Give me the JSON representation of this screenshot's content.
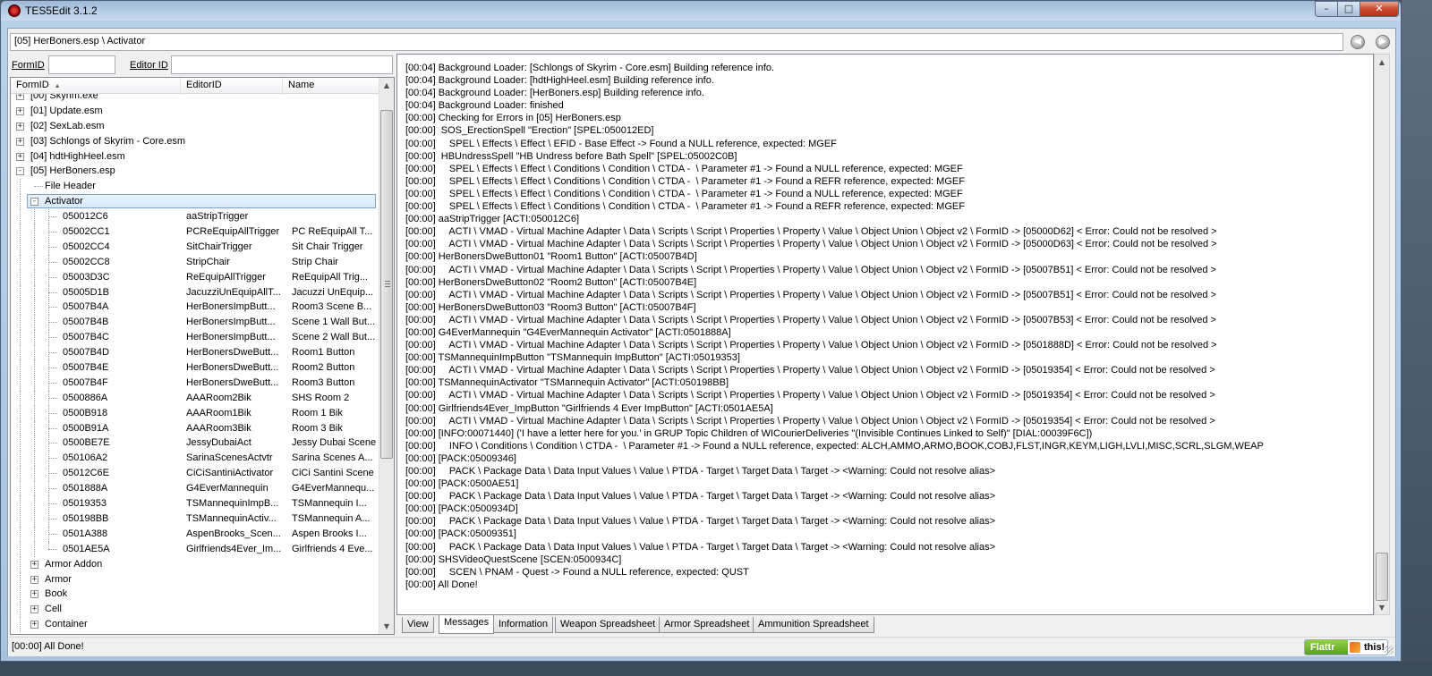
{
  "window": {
    "title": "TES5Edit 3.1.2",
    "minimize": "–",
    "maximize": "□",
    "close": "✕"
  },
  "path": {
    "value": "[05] HerBoners.esp \\ Activator",
    "back_icon": "arrow-left-icon",
    "forward_icon": "arrow-right-icon"
  },
  "filters": {
    "formid_label": "FormID",
    "formid_value": "",
    "editorid_label": "Editor ID",
    "editorid_value": ""
  },
  "tree": {
    "columns": [
      "FormID",
      "EditorID",
      "Name"
    ],
    "rows": [
      {
        "level": 0,
        "exp": "+",
        "formid": "[00] Skyrim.exe",
        "editorid": "",
        "name": ""
      },
      {
        "level": 0,
        "exp": "+",
        "formid": "[01] Update.esm",
        "editorid": "",
        "name": ""
      },
      {
        "level": 0,
        "exp": "+",
        "formid": "[02] SexLab.esm",
        "editorid": "",
        "name": ""
      },
      {
        "level": 0,
        "exp": "+",
        "formid": "[03] Schlongs of Skyrim - Core.esm",
        "editorid": "",
        "name": ""
      },
      {
        "level": 0,
        "exp": "+",
        "formid": "[04] hdtHighHeel.esm",
        "editorid": "",
        "name": ""
      },
      {
        "level": 0,
        "exp": "−",
        "formid": "[05] HerBoners.esp",
        "editorid": "",
        "name": ""
      },
      {
        "level": 1,
        "exp": "",
        "formid": "File Header",
        "editorid": "",
        "name": ""
      },
      {
        "level": 1,
        "exp": "−",
        "formid": "Activator",
        "editorid": "",
        "name": "",
        "selected": true
      },
      {
        "level": 2,
        "exp": "",
        "formid": "050012C6",
        "editorid": "aaStripTrigger",
        "name": ""
      },
      {
        "level": 2,
        "exp": "",
        "formid": "05002CC1",
        "editorid": "PCReEquipAllTrigger",
        "name": "PC ReEquipAll T..."
      },
      {
        "level": 2,
        "exp": "",
        "formid": "05002CC4",
        "editorid": "SitChairTrigger",
        "name": "Sit Chair Trigger"
      },
      {
        "level": 2,
        "exp": "",
        "formid": "05002CC8",
        "editorid": "StripChair",
        "name": "Strip Chair"
      },
      {
        "level": 2,
        "exp": "",
        "formid": "05003D3C",
        "editorid": "ReEquipAllTrigger",
        "name": "ReEquipAll Trig..."
      },
      {
        "level": 2,
        "exp": "",
        "formid": "05005D1B",
        "editorid": "JacuzziUnEquipAllT...",
        "name": "Jacuzzi UnEquip..."
      },
      {
        "level": 2,
        "exp": "",
        "formid": "05007B4A",
        "editorid": "HerBonersImpButt...",
        "name": "Room3 Scene B..."
      },
      {
        "level": 2,
        "exp": "",
        "formid": "05007B4B",
        "editorid": "HerBonersImpButt...",
        "name": "Scene 1 Wall But..."
      },
      {
        "level": 2,
        "exp": "",
        "formid": "05007B4C",
        "editorid": "HerBonersImpButt...",
        "name": "Scene 2 Wall But..."
      },
      {
        "level": 2,
        "exp": "",
        "formid": "05007B4D",
        "editorid": "HerBonersDweButt...",
        "name": "Room1 Button"
      },
      {
        "level": 2,
        "exp": "",
        "formid": "05007B4E",
        "editorid": "HerBonersDweButt...",
        "name": "Room2 Button"
      },
      {
        "level": 2,
        "exp": "",
        "formid": "05007B4F",
        "editorid": "HerBonersDweButt...",
        "name": "Room3 Button"
      },
      {
        "level": 2,
        "exp": "",
        "formid": "0500886A",
        "editorid": "AAARoom2Bik",
        "name": "SHS Room 2"
      },
      {
        "level": 2,
        "exp": "",
        "formid": "0500B918",
        "editorid": "AAARoom1Bik",
        "name": "Room 1 Bik"
      },
      {
        "level": 2,
        "exp": "",
        "formid": "0500B91A",
        "editorid": "AAARoom3Bik",
        "name": "Room 3 Bik"
      },
      {
        "level": 2,
        "exp": "",
        "formid": "0500BE7E",
        "editorid": "JessyDubaiAct",
        "name": "Jessy Dubai Scene"
      },
      {
        "level": 2,
        "exp": "",
        "formid": "050106A2",
        "editorid": "SarinaScenesActvtr",
        "name": "Sarina Scenes A..."
      },
      {
        "level": 2,
        "exp": "",
        "formid": "05012C6E",
        "editorid": "CiCiSantiniActivator",
        "name": "CiCi Santini Scene"
      },
      {
        "level": 2,
        "exp": "",
        "formid": "0501888A",
        "editorid": "G4EverMannequin",
        "name": "G4EverMannequ..."
      },
      {
        "level": 2,
        "exp": "",
        "formid": "05019353",
        "editorid": "TSMannequinImpB...",
        "name": "TSMannequin I..."
      },
      {
        "level": 2,
        "exp": "",
        "formid": "050198BB",
        "editorid": "TSMannequinActiv...",
        "name": "TSMannequin A..."
      },
      {
        "level": 2,
        "exp": "",
        "formid": "0501A388",
        "editorid": "AspenBrooks_Scen...",
        "name": "Aspen Brooks I..."
      },
      {
        "level": 2,
        "exp": "",
        "formid": "0501AE5A",
        "editorid": "Girlfriends4Ever_Im...",
        "name": "Girlfriends 4 Eve..."
      },
      {
        "level": 1,
        "exp": "+",
        "formid": "Armor Addon",
        "editorid": "",
        "name": ""
      },
      {
        "level": 1,
        "exp": "+",
        "formid": "Armor",
        "editorid": "",
        "name": ""
      },
      {
        "level": 1,
        "exp": "+",
        "formid": "Book",
        "editorid": "",
        "name": ""
      },
      {
        "level": 1,
        "exp": "+",
        "formid": "Cell",
        "editorid": "",
        "name": ""
      },
      {
        "level": 1,
        "exp": "+",
        "formid": "Container",
        "editorid": "",
        "name": ""
      }
    ]
  },
  "messages": [
    "[00:04] Background Loader: [Schlongs of Skyrim - Core.esm] Building reference info.",
    "[00:04] Background Loader: [hdtHighHeel.esm] Building reference info.",
    "[00:04] Background Loader: [HerBoners.esp] Building reference info.",
    "[00:04] Background Loader: finished",
    "[00:00] Checking for Errors in [05] HerBoners.esp",
    "[00:00]  SOS_ErectionSpell \"Erection\" [SPEL:050012ED]",
    "[00:00]     SPEL \\ Effects \\ Effect \\ EFID - Base Effect -> Found a NULL reference, expected: MGEF",
    "[00:00]  HBUndressSpell \"HB Undress before Bath Spell\" [SPEL:05002C0B]",
    "[00:00]     SPEL \\ Effects \\ Effect \\ Conditions \\ Condition \\ CTDA -  \\ Parameter #1 -> Found a NULL reference, expected: MGEF",
    "[00:00]     SPEL \\ Effects \\ Effect \\ Conditions \\ Condition \\ CTDA -  \\ Parameter #1 -> Found a REFR reference, expected: MGEF",
    "[00:00]     SPEL \\ Effects \\ Effect \\ Conditions \\ Condition \\ CTDA -  \\ Parameter #1 -> Found a NULL reference, expected: MGEF",
    "[00:00]     SPEL \\ Effects \\ Effect \\ Conditions \\ Condition \\ CTDA -  \\ Parameter #1 -> Found a REFR reference, expected: MGEF",
    "[00:00] aaStripTrigger [ACTI:050012C6]",
    "[00:00]     ACTI \\ VMAD - Virtual Machine Adapter \\ Data \\ Scripts \\ Script \\ Properties \\ Property \\ Value \\ Object Union \\ Object v2 \\ FormID -> [05000D62] < Error: Could not be resolved >",
    "[00:00]     ACTI \\ VMAD - Virtual Machine Adapter \\ Data \\ Scripts \\ Script \\ Properties \\ Property \\ Value \\ Object Union \\ Object v2 \\ FormID -> [05000D63] < Error: Could not be resolved >",
    "[00:00] HerBonersDweButton01 \"Room1 Button\" [ACTI:05007B4D]",
    "[00:00]     ACTI \\ VMAD - Virtual Machine Adapter \\ Data \\ Scripts \\ Script \\ Properties \\ Property \\ Value \\ Object Union \\ Object v2 \\ FormID -> [05007B51] < Error: Could not be resolved >",
    "[00:00] HerBonersDweButton02 \"Room2 Button\" [ACTI:05007B4E]",
    "[00:00]     ACTI \\ VMAD - Virtual Machine Adapter \\ Data \\ Scripts \\ Script \\ Properties \\ Property \\ Value \\ Object Union \\ Object v2 \\ FormID -> [05007B51] < Error: Could not be resolved >",
    "[00:00] HerBonersDweButton03 \"Room3 Button\" [ACTI:05007B4F]",
    "[00:00]     ACTI \\ VMAD - Virtual Machine Adapter \\ Data \\ Scripts \\ Script \\ Properties \\ Property \\ Value \\ Object Union \\ Object v2 \\ FormID -> [05007B53] < Error: Could not be resolved >",
    "[00:00] G4EverMannequin \"G4EverMannequin Activator\" [ACTI:0501888A]",
    "[00:00]     ACTI \\ VMAD - Virtual Machine Adapter \\ Data \\ Scripts \\ Script \\ Properties \\ Property \\ Value \\ Object Union \\ Object v2 \\ FormID -> [0501888D] < Error: Could not be resolved >",
    "[00:00] TSMannequinImpButton \"TSMannequin ImpButton\" [ACTI:05019353]",
    "[00:00]     ACTI \\ VMAD - Virtual Machine Adapter \\ Data \\ Scripts \\ Script \\ Properties \\ Property \\ Value \\ Object Union \\ Object v2 \\ FormID -> [05019354] < Error: Could not be resolved >",
    "[00:00] TSMannequinActivator \"TSMannequin Activator\" [ACTI:050198BB]",
    "[00:00]     ACTI \\ VMAD - Virtual Machine Adapter \\ Data \\ Scripts \\ Script \\ Properties \\ Property \\ Value \\ Object Union \\ Object v2 \\ FormID -> [05019354] < Error: Could not be resolved >",
    "[00:00] Girlfriends4Ever_ImpButton \"Girlfriends 4 Ever ImpButton\" [ACTI:0501AE5A]",
    "[00:00]     ACTI \\ VMAD - Virtual Machine Adapter \\ Data \\ Scripts \\ Script \\ Properties \\ Property \\ Value \\ Object Union \\ Object v2 \\ FormID -> [05019354] < Error: Could not be resolved >",
    "[00:00] [INFO:00071440] ('I have a letter here for you.' in GRUP Topic Children of WICourierDeliveries \"(Invisible Continues Linked to Self)\" [DIAL:00039F6C])",
    "[00:00]     INFO \\ Conditions \\ Condition \\ CTDA -  \\ Parameter #1 -> Found a NULL reference, expected: ALCH,AMMO,ARMO,BOOK,COBJ,FLST,INGR,KEYM,LIGH,LVLI,MISC,SCRL,SLGM,WEAP",
    "[00:00] [PACK:05009346]",
    "[00:00]     PACK \\ Package Data \\ Data Input Values \\ Value \\ PTDA - Target \\ Target Data \\ Target -> <Warning: Could not resolve alias>",
    "[00:00] [PACK:0500AE51]",
    "[00:00]     PACK \\ Package Data \\ Data Input Values \\ Value \\ PTDA - Target \\ Target Data \\ Target -> <Warning: Could not resolve alias>",
    "[00:00] [PACK:0500934D]",
    "[00:00]     PACK \\ Package Data \\ Data Input Values \\ Value \\ PTDA - Target \\ Target Data \\ Target -> <Warning: Could not resolve alias>",
    "[00:00] [PACK:05009351]",
    "[00:00]     PACK \\ Package Data \\ Data Input Values \\ Value \\ PTDA - Target \\ Target Data \\ Target -> <Warning: Could not resolve alias>",
    "[00:00] SHSVideoQuestScene [SCEN:0500934C]",
    "[00:00]     SCEN \\ PNAM - Quest -> Found a NULL reference, expected: QUST",
    "[00:00] All Done!"
  ],
  "tabs": [
    "View",
    "Messages",
    "Information",
    "Weapon Spreadsheet",
    "Armor Spreadsheet",
    "Ammunition Spreadsheet"
  ],
  "active_tab": "Messages",
  "status": {
    "text": "[00:00] All Done!",
    "flattr_left": "Flattr",
    "flattr_right": "this!"
  },
  "colors": {
    "selection_border": "#7da2ce",
    "flattr_green": "#6cb52a"
  }
}
